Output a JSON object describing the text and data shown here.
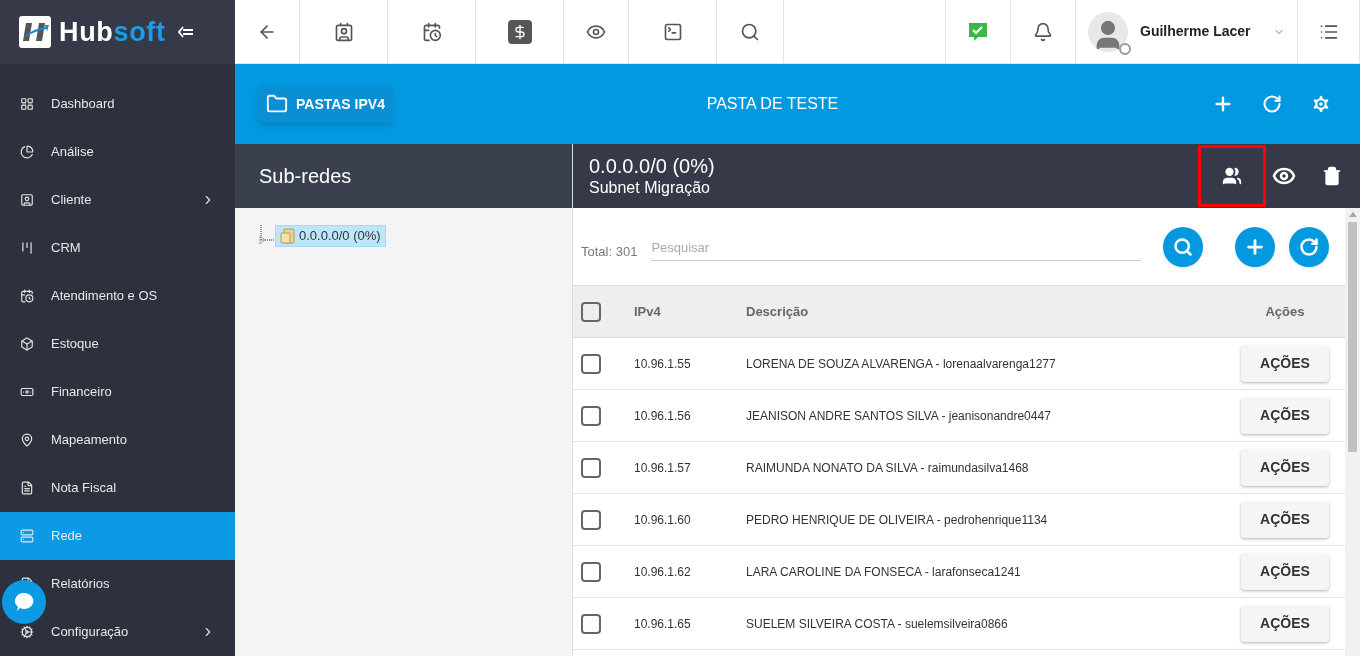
{
  "logo": {
    "text_a": "Hub",
    "text_b": "soft"
  },
  "sidebar": {
    "items": [
      {
        "label": "Dashboard",
        "selected": false,
        "has_children": false
      },
      {
        "label": "Análise",
        "selected": false,
        "has_children": false
      },
      {
        "label": "Cliente",
        "selected": false,
        "has_children": true
      },
      {
        "label": "CRM",
        "selected": false,
        "has_children": false
      },
      {
        "label": "Atendimento e OS",
        "selected": false,
        "has_children": false
      },
      {
        "label": "Estoque",
        "selected": false,
        "has_children": false
      },
      {
        "label": "Financeiro",
        "selected": false,
        "has_children": false
      },
      {
        "label": "Mapeamento",
        "selected": false,
        "has_children": false
      },
      {
        "label": "Nota Fiscal",
        "selected": false,
        "has_children": false
      },
      {
        "label": "Rede",
        "selected": true,
        "has_children": false
      },
      {
        "label": "Relatórios",
        "selected": false,
        "has_children": false
      },
      {
        "label": "Configuração",
        "selected": false,
        "has_children": true
      }
    ]
  },
  "topbar": {
    "user_name": "Guilherme Lacer"
  },
  "folder_bar": {
    "folder_button": "PASTAS IPV4",
    "title": "PASTA DE TESTE"
  },
  "subnets_panel": {
    "title": "Sub-redes",
    "tree": [
      {
        "label": "0.0.0.0/0 (0%)",
        "selected": true
      }
    ]
  },
  "subnet_header": {
    "title": "0.0.0.0/0 (0%)",
    "subtitle": "Subnet Migração"
  },
  "table_toolbar": {
    "total": "Total: 301",
    "search_placeholder": "Pesquisar"
  },
  "table": {
    "columns": [
      "IPv4",
      "Descrição",
      "Ações"
    ],
    "select_all_checked": false,
    "rows": [
      {
        "ip": "10.96.1.55",
        "description": "LORENA DE SOUZA ALVARENGA - lorenaalvarenga1277",
        "action": "AÇÕES",
        "checked": false
      },
      {
        "ip": "10.96.1.56",
        "description": "JEANISON ANDRE SANTOS SILVA - jeanisonandre0447",
        "action": "AÇÕES",
        "checked": false
      },
      {
        "ip": "10.96.1.57",
        "description": "RAIMUNDA NONATO DA SILVA - raimundasilva1468",
        "action": "AÇÕES",
        "checked": false
      },
      {
        "ip": "10.96.1.60",
        "description": "PEDRO HENRIQUE DE OLIVEIRA - pedrohenrique1134",
        "action": "AÇÕES",
        "checked": false
      },
      {
        "ip": "10.96.1.62",
        "description": "LARA CAROLINE DA FONSECA - larafonseca1241",
        "action": "AÇÕES",
        "checked": false
      },
      {
        "ip": "10.96.1.65",
        "description": "SUELEM SILVEIRA COSTA - suelemsilveira0866",
        "action": "AÇÕES",
        "checked": false
      }
    ]
  }
}
